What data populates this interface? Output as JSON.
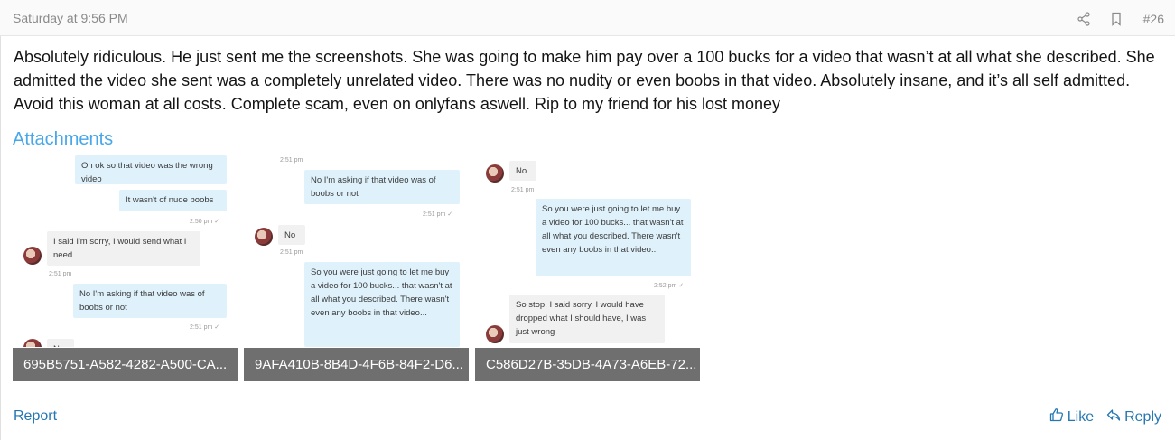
{
  "post": {
    "date": "Saturday at 9:56 PM",
    "number": "#26",
    "body": "Absolutely ridiculous. He just sent me the screenshots. She was going to make him pay over a 100 bucks for a video that wasn’t at all what she described. She admitted the video she sent was a completely unrelated video. There was no nudity or even boobs in that video. Absolutely insane, and it’s all self admitted. Avoid this woman at all costs. Complete scam, even on onlyfans aswell. Rip to my friend for his lost money"
  },
  "attachments": {
    "title": "Attachments",
    "items": [
      {
        "filename": "695B5751-A582-4282-A500-CA...",
        "messages": {
          "m1": "Oh ok so that video was the wrong video",
          "m2": "It wasn't of nude boobs",
          "t1": "2:50 pm ✓",
          "m3": "I said I'm sorry, I would send what I need",
          "t2": "2:51 pm",
          "m4": "No I'm asking if that video was of boobs or not",
          "t3": "2:51 pm ✓",
          "m5": "No"
        }
      },
      {
        "filename": "9AFA410B-8B4D-4F6B-84F2-D6...",
        "messages": {
          "t0": "2:51 pm",
          "m1": "No I'm asking if that video was of boobs or not",
          "t1": "2:51 pm ✓",
          "m2": "No",
          "t2": "2:51 pm",
          "m3": "So you were just going to let me buy a video for 100 bucks... that wasn't at all what you described. There wasn't even any boobs in that video..."
        }
      },
      {
        "filename": "C586D27B-35DB-4A73-A6EB-72...",
        "messages": {
          "m1": "No",
          "t1": "2:51 pm",
          "m2": "So you were just going to let me buy a video for 100 bucks... that wasn't at all what you described. There wasn't even any boobs in that video...",
          "t2": "2:52 pm ✓",
          "m3": "So stop, I said sorry, I would have dropped what I should have, I was just wrong"
        }
      }
    ]
  },
  "footer": {
    "report": "Report",
    "like": "Like",
    "reply": "Reply"
  },
  "colors": {
    "link": "#2577b1",
    "attachments_title": "#47a7eb",
    "filename_bar": "#6f6f6f",
    "my_bubble": "#dff1fb",
    "their_bubble": "#f1f1f1"
  },
  "icons": [
    "share-icon",
    "bookmark-icon",
    "thumbs-up-icon",
    "reply-icon"
  ]
}
